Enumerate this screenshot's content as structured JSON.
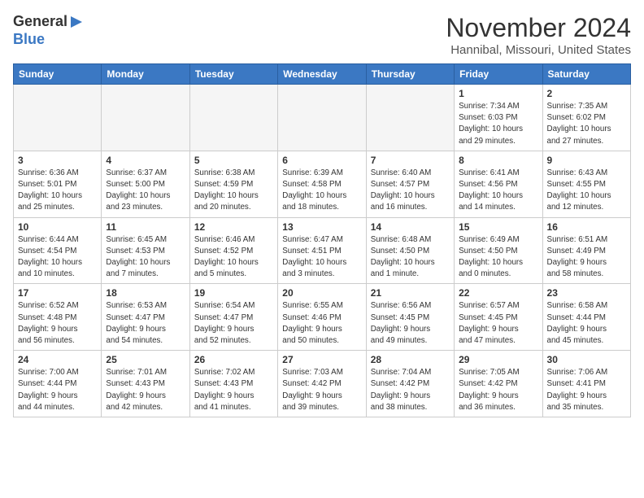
{
  "header": {
    "logo_line1": "General",
    "logo_line2": "Blue",
    "month_title": "November 2024",
    "location": "Hannibal, Missouri, United States"
  },
  "weekdays": [
    "Sunday",
    "Monday",
    "Tuesday",
    "Wednesday",
    "Thursday",
    "Friday",
    "Saturday"
  ],
  "weeks": [
    [
      {
        "day": "",
        "info": ""
      },
      {
        "day": "",
        "info": ""
      },
      {
        "day": "",
        "info": ""
      },
      {
        "day": "",
        "info": ""
      },
      {
        "day": "",
        "info": ""
      },
      {
        "day": "1",
        "info": "Sunrise: 7:34 AM\nSunset: 6:03 PM\nDaylight: 10 hours\nand 29 minutes."
      },
      {
        "day": "2",
        "info": "Sunrise: 7:35 AM\nSunset: 6:02 PM\nDaylight: 10 hours\nand 27 minutes."
      }
    ],
    [
      {
        "day": "3",
        "info": "Sunrise: 6:36 AM\nSunset: 5:01 PM\nDaylight: 10 hours\nand 25 minutes."
      },
      {
        "day": "4",
        "info": "Sunrise: 6:37 AM\nSunset: 5:00 PM\nDaylight: 10 hours\nand 23 minutes."
      },
      {
        "day": "5",
        "info": "Sunrise: 6:38 AM\nSunset: 4:59 PM\nDaylight: 10 hours\nand 20 minutes."
      },
      {
        "day": "6",
        "info": "Sunrise: 6:39 AM\nSunset: 4:58 PM\nDaylight: 10 hours\nand 18 minutes."
      },
      {
        "day": "7",
        "info": "Sunrise: 6:40 AM\nSunset: 4:57 PM\nDaylight: 10 hours\nand 16 minutes."
      },
      {
        "day": "8",
        "info": "Sunrise: 6:41 AM\nSunset: 4:56 PM\nDaylight: 10 hours\nand 14 minutes."
      },
      {
        "day": "9",
        "info": "Sunrise: 6:43 AM\nSunset: 4:55 PM\nDaylight: 10 hours\nand 12 minutes."
      }
    ],
    [
      {
        "day": "10",
        "info": "Sunrise: 6:44 AM\nSunset: 4:54 PM\nDaylight: 10 hours\nand 10 minutes."
      },
      {
        "day": "11",
        "info": "Sunrise: 6:45 AM\nSunset: 4:53 PM\nDaylight: 10 hours\nand 7 minutes."
      },
      {
        "day": "12",
        "info": "Sunrise: 6:46 AM\nSunset: 4:52 PM\nDaylight: 10 hours\nand 5 minutes."
      },
      {
        "day": "13",
        "info": "Sunrise: 6:47 AM\nSunset: 4:51 PM\nDaylight: 10 hours\nand 3 minutes."
      },
      {
        "day": "14",
        "info": "Sunrise: 6:48 AM\nSunset: 4:50 PM\nDaylight: 10 hours\nand 1 minute."
      },
      {
        "day": "15",
        "info": "Sunrise: 6:49 AM\nSunset: 4:50 PM\nDaylight: 10 hours\nand 0 minutes."
      },
      {
        "day": "16",
        "info": "Sunrise: 6:51 AM\nSunset: 4:49 PM\nDaylight: 9 hours\nand 58 minutes."
      }
    ],
    [
      {
        "day": "17",
        "info": "Sunrise: 6:52 AM\nSunset: 4:48 PM\nDaylight: 9 hours\nand 56 minutes."
      },
      {
        "day": "18",
        "info": "Sunrise: 6:53 AM\nSunset: 4:47 PM\nDaylight: 9 hours\nand 54 minutes."
      },
      {
        "day": "19",
        "info": "Sunrise: 6:54 AM\nSunset: 4:47 PM\nDaylight: 9 hours\nand 52 minutes."
      },
      {
        "day": "20",
        "info": "Sunrise: 6:55 AM\nSunset: 4:46 PM\nDaylight: 9 hours\nand 50 minutes."
      },
      {
        "day": "21",
        "info": "Sunrise: 6:56 AM\nSunset: 4:45 PM\nDaylight: 9 hours\nand 49 minutes."
      },
      {
        "day": "22",
        "info": "Sunrise: 6:57 AM\nSunset: 4:45 PM\nDaylight: 9 hours\nand 47 minutes."
      },
      {
        "day": "23",
        "info": "Sunrise: 6:58 AM\nSunset: 4:44 PM\nDaylight: 9 hours\nand 45 minutes."
      }
    ],
    [
      {
        "day": "24",
        "info": "Sunrise: 7:00 AM\nSunset: 4:44 PM\nDaylight: 9 hours\nand 44 minutes."
      },
      {
        "day": "25",
        "info": "Sunrise: 7:01 AM\nSunset: 4:43 PM\nDaylight: 9 hours\nand 42 minutes."
      },
      {
        "day": "26",
        "info": "Sunrise: 7:02 AM\nSunset: 4:43 PM\nDaylight: 9 hours\nand 41 minutes."
      },
      {
        "day": "27",
        "info": "Sunrise: 7:03 AM\nSunset: 4:42 PM\nDaylight: 9 hours\nand 39 minutes."
      },
      {
        "day": "28",
        "info": "Sunrise: 7:04 AM\nSunset: 4:42 PM\nDaylight: 9 hours\nand 38 minutes."
      },
      {
        "day": "29",
        "info": "Sunrise: 7:05 AM\nSunset: 4:42 PM\nDaylight: 9 hours\nand 36 minutes."
      },
      {
        "day": "30",
        "info": "Sunrise: 7:06 AM\nSunset: 4:41 PM\nDaylight: 9 hours\nand 35 minutes."
      }
    ]
  ]
}
